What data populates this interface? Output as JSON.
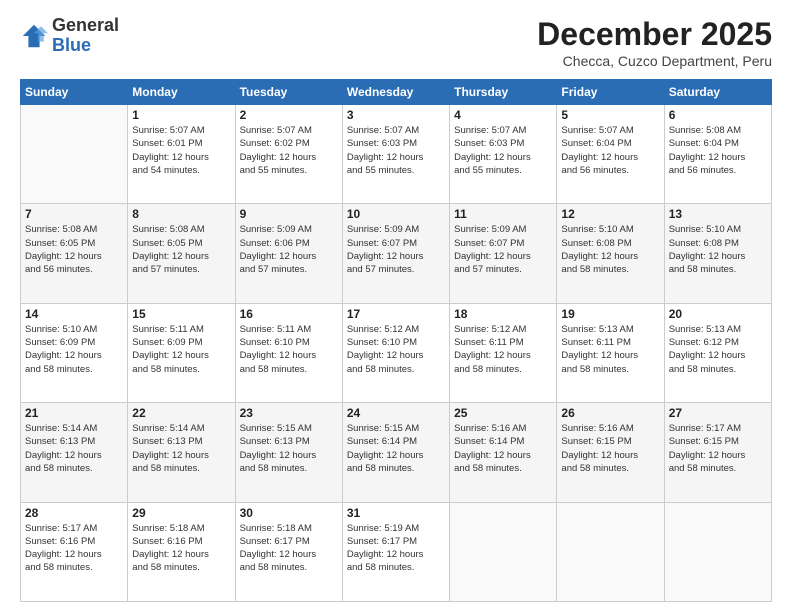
{
  "header": {
    "logo_general": "General",
    "logo_blue": "Blue",
    "month_title": "December 2025",
    "subtitle": "Checca, Cuzco Department, Peru"
  },
  "days_of_week": [
    "Sunday",
    "Monday",
    "Tuesday",
    "Wednesday",
    "Thursday",
    "Friday",
    "Saturday"
  ],
  "weeks": [
    [
      {
        "day": "",
        "info": ""
      },
      {
        "day": "1",
        "info": "Sunrise: 5:07 AM\nSunset: 6:01 PM\nDaylight: 12 hours\nand 54 minutes."
      },
      {
        "day": "2",
        "info": "Sunrise: 5:07 AM\nSunset: 6:02 PM\nDaylight: 12 hours\nand 55 minutes."
      },
      {
        "day": "3",
        "info": "Sunrise: 5:07 AM\nSunset: 6:03 PM\nDaylight: 12 hours\nand 55 minutes."
      },
      {
        "day": "4",
        "info": "Sunrise: 5:07 AM\nSunset: 6:03 PM\nDaylight: 12 hours\nand 55 minutes."
      },
      {
        "day": "5",
        "info": "Sunrise: 5:07 AM\nSunset: 6:04 PM\nDaylight: 12 hours\nand 56 minutes."
      },
      {
        "day": "6",
        "info": "Sunrise: 5:08 AM\nSunset: 6:04 PM\nDaylight: 12 hours\nand 56 minutes."
      }
    ],
    [
      {
        "day": "7",
        "info": "Sunrise: 5:08 AM\nSunset: 6:05 PM\nDaylight: 12 hours\nand 56 minutes."
      },
      {
        "day": "8",
        "info": "Sunrise: 5:08 AM\nSunset: 6:05 PM\nDaylight: 12 hours\nand 57 minutes."
      },
      {
        "day": "9",
        "info": "Sunrise: 5:09 AM\nSunset: 6:06 PM\nDaylight: 12 hours\nand 57 minutes."
      },
      {
        "day": "10",
        "info": "Sunrise: 5:09 AM\nSunset: 6:07 PM\nDaylight: 12 hours\nand 57 minutes."
      },
      {
        "day": "11",
        "info": "Sunrise: 5:09 AM\nSunset: 6:07 PM\nDaylight: 12 hours\nand 57 minutes."
      },
      {
        "day": "12",
        "info": "Sunrise: 5:10 AM\nSunset: 6:08 PM\nDaylight: 12 hours\nand 58 minutes."
      },
      {
        "day": "13",
        "info": "Sunrise: 5:10 AM\nSunset: 6:08 PM\nDaylight: 12 hours\nand 58 minutes."
      }
    ],
    [
      {
        "day": "14",
        "info": "Sunrise: 5:10 AM\nSunset: 6:09 PM\nDaylight: 12 hours\nand 58 minutes."
      },
      {
        "day": "15",
        "info": "Sunrise: 5:11 AM\nSunset: 6:09 PM\nDaylight: 12 hours\nand 58 minutes."
      },
      {
        "day": "16",
        "info": "Sunrise: 5:11 AM\nSunset: 6:10 PM\nDaylight: 12 hours\nand 58 minutes."
      },
      {
        "day": "17",
        "info": "Sunrise: 5:12 AM\nSunset: 6:10 PM\nDaylight: 12 hours\nand 58 minutes."
      },
      {
        "day": "18",
        "info": "Sunrise: 5:12 AM\nSunset: 6:11 PM\nDaylight: 12 hours\nand 58 minutes."
      },
      {
        "day": "19",
        "info": "Sunrise: 5:13 AM\nSunset: 6:11 PM\nDaylight: 12 hours\nand 58 minutes."
      },
      {
        "day": "20",
        "info": "Sunrise: 5:13 AM\nSunset: 6:12 PM\nDaylight: 12 hours\nand 58 minutes."
      }
    ],
    [
      {
        "day": "21",
        "info": "Sunrise: 5:14 AM\nSunset: 6:13 PM\nDaylight: 12 hours\nand 58 minutes."
      },
      {
        "day": "22",
        "info": "Sunrise: 5:14 AM\nSunset: 6:13 PM\nDaylight: 12 hours\nand 58 minutes."
      },
      {
        "day": "23",
        "info": "Sunrise: 5:15 AM\nSunset: 6:13 PM\nDaylight: 12 hours\nand 58 minutes."
      },
      {
        "day": "24",
        "info": "Sunrise: 5:15 AM\nSunset: 6:14 PM\nDaylight: 12 hours\nand 58 minutes."
      },
      {
        "day": "25",
        "info": "Sunrise: 5:16 AM\nSunset: 6:14 PM\nDaylight: 12 hours\nand 58 minutes."
      },
      {
        "day": "26",
        "info": "Sunrise: 5:16 AM\nSunset: 6:15 PM\nDaylight: 12 hours\nand 58 minutes."
      },
      {
        "day": "27",
        "info": "Sunrise: 5:17 AM\nSunset: 6:15 PM\nDaylight: 12 hours\nand 58 minutes."
      }
    ],
    [
      {
        "day": "28",
        "info": "Sunrise: 5:17 AM\nSunset: 6:16 PM\nDaylight: 12 hours\nand 58 minutes."
      },
      {
        "day": "29",
        "info": "Sunrise: 5:18 AM\nSunset: 6:16 PM\nDaylight: 12 hours\nand 58 minutes."
      },
      {
        "day": "30",
        "info": "Sunrise: 5:18 AM\nSunset: 6:17 PM\nDaylight: 12 hours\nand 58 minutes."
      },
      {
        "day": "31",
        "info": "Sunrise: 5:19 AM\nSunset: 6:17 PM\nDaylight: 12 hours\nand 58 minutes."
      },
      {
        "day": "",
        "info": ""
      },
      {
        "day": "",
        "info": ""
      },
      {
        "day": "",
        "info": ""
      }
    ]
  ]
}
